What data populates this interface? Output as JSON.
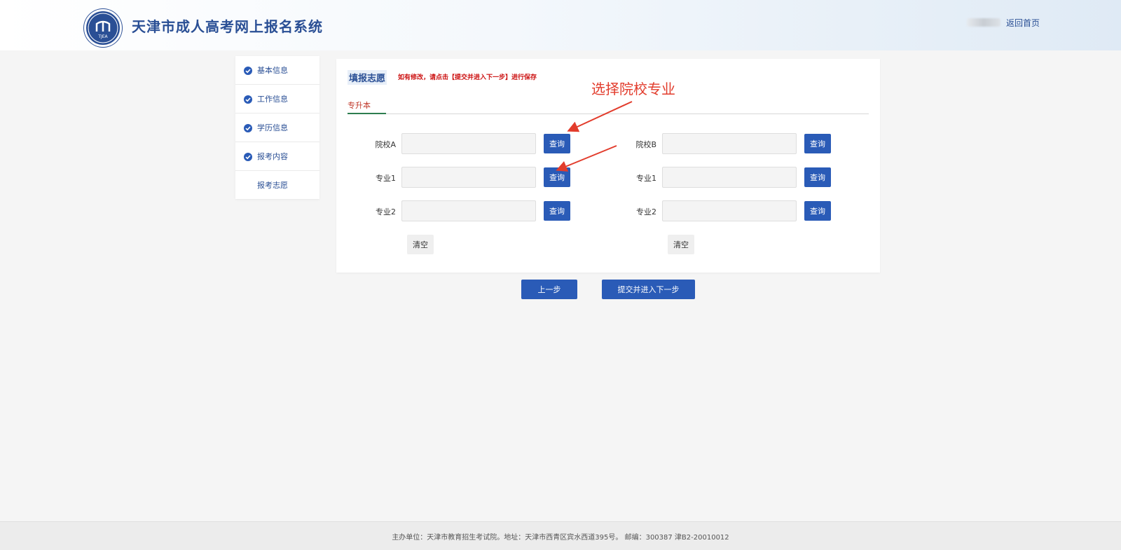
{
  "header": {
    "title": "天津市成人高考网上报名系统",
    "home_link": "返回首页",
    "logo_icon": "tjea-logo-icon",
    "logo_text": "TJEA"
  },
  "sidebar": {
    "items": [
      {
        "label": "基本信息",
        "completed": true
      },
      {
        "label": "工作信息",
        "completed": true
      },
      {
        "label": "学历信息",
        "completed": true
      },
      {
        "label": "报考内容",
        "completed": true
      },
      {
        "label": "报考志愿",
        "completed": false
      }
    ]
  },
  "panel": {
    "title": "填报志愿",
    "note": "如有修改，请点击【提交并进入下一步】进行保存",
    "tab": "专升本",
    "left": {
      "school_label": "院校A",
      "major1_label": "专业1",
      "major2_label": "专业2",
      "query_label": "查询",
      "clear_label": "清空",
      "school_value": "",
      "major1_value": "",
      "major2_value": ""
    },
    "right": {
      "school_label": "院校B",
      "major1_label": "专业1",
      "major2_label": "专业2",
      "query_label": "查询",
      "clear_label": "清空",
      "school_value": "",
      "major1_value": "",
      "major2_value": ""
    }
  },
  "annotation": {
    "text": "选择院校专业",
    "color": "#e23c2c"
  },
  "actions": {
    "prev_label": "上一步",
    "next_label": "提交并进入下一步"
  },
  "footer": {
    "text": "主办单位：天津市教育招生考试院。地址：天津市西青区宾水西道395号。 邮编：300387 津B2-20010012"
  },
  "colors": {
    "primary": "#2a5bb7",
    "title_blue": "#2a4f95",
    "note_red": "#cc1111",
    "tab_green": "#2e7d4f"
  }
}
